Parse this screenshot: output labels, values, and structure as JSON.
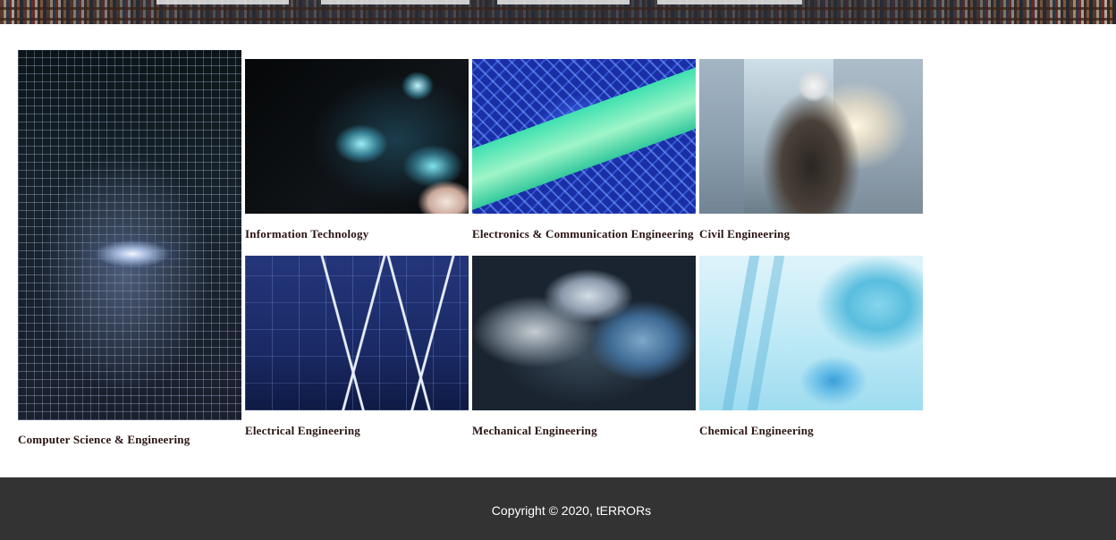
{
  "departments": [
    {
      "id": "cse",
      "label": "Computer Science & Engineering"
    },
    {
      "id": "it",
      "label": "Information Technology"
    },
    {
      "id": "ece",
      "label": "Electronics & Communication Engineering"
    },
    {
      "id": "civil",
      "label": "Civil Engineering"
    },
    {
      "id": "ee",
      "label": "Electrical Engineering"
    },
    {
      "id": "me",
      "label": "Mechanical Engineering"
    },
    {
      "id": "che",
      "label": "Chemical Engineering"
    }
  ],
  "footer": {
    "copyright": "Copyright © 2020, tERRORs"
  },
  "colors": {
    "label_text": "#2a1212",
    "footer_bg": "#333333",
    "footer_text": "#ffffff"
  }
}
